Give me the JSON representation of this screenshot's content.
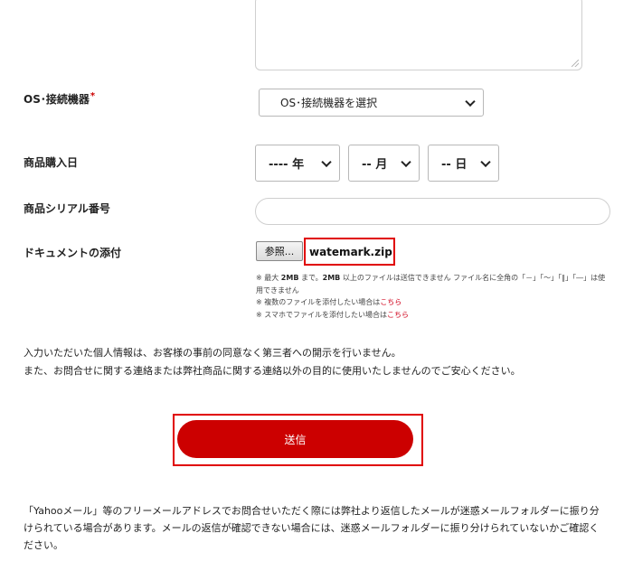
{
  "form": {
    "os_device": {
      "label": "OS･接続機器",
      "required_mark": "*",
      "select_value": "OS･接続機器を選択"
    },
    "purchase_date": {
      "label": "商品購入日",
      "year": "---- 年",
      "month": "-- 月",
      "day": "-- 日"
    },
    "serial": {
      "label": "商品シリアル番号",
      "value": ""
    },
    "attachment": {
      "label": "ドキュメントの添付",
      "browse_label": "参照...",
      "file_name": "watemark.zip",
      "note1_a": "※ 最大 ",
      "note1_b": "2MB",
      "note1_c": " まで。",
      "note1_d": "2MB",
      "note1_e": " 以上のファイルは送信できません ファイル名に全角の「－」「～」「∥」「―」は使",
      "note1_f": "用できません",
      "note2_text": "※ 複数のファイルを添付したい場合は",
      "note2_link": "こちら",
      "note3_text": "※ スマホでファイルを添付したい場合は",
      "note3_link": "こちら"
    }
  },
  "privacy": {
    "line1": "入力いただいた個人情報は、お客様の事前の同意なく第三者への開示を行いません。",
    "line2": "また、お問合せに関する連絡または弊社商品に関する連絡以外の目的に使用いたしませんのでご安心ください。"
  },
  "submit": {
    "label": "送信"
  },
  "footer": {
    "line1": "「Yahooメール」等のフリーメールアドレスでお問合せいただく際には弊社より返信したメールが迷惑メールフォルダーに振り分",
    "line2": "けられている場合があります。メールの返信が確認できない場合には、迷惑メールフォルダーに振り分けられていないかご確認く",
    "line3": "ださい。"
  },
  "colors": {
    "accent_red": "#cc0000",
    "highlight_red": "#e00000",
    "link_red": "#d0021b"
  }
}
